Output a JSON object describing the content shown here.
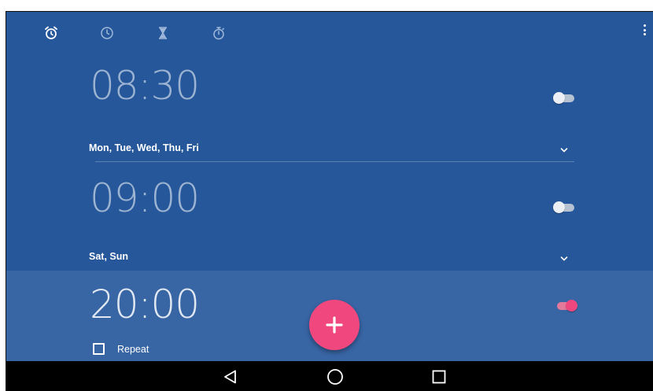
{
  "tabs": [
    {
      "icon": "alarm-icon",
      "active": true
    },
    {
      "icon": "clock-icon",
      "active": false
    },
    {
      "icon": "timer-icon",
      "active": false
    },
    {
      "icon": "stopwatch-icon",
      "active": false
    }
  ],
  "alarms": [
    {
      "time": "08:30",
      "days": "Mon, Tue, Wed, Thu, Fri",
      "enabled": false
    },
    {
      "time": "09:00",
      "days": "Sat, Sun",
      "enabled": false
    },
    {
      "time": "20:00",
      "repeat_label": "Repeat",
      "repeat_checked": false,
      "enabled": true
    }
  ],
  "colors": {
    "background": "#25579a",
    "expanded_alarm": "#3865a4",
    "accent": "#f0487e",
    "navbar": "#000000"
  },
  "fab": {
    "icon": "plus-icon"
  },
  "navbar": {
    "buttons": [
      "back-icon",
      "home-icon",
      "recents-icon"
    ]
  }
}
